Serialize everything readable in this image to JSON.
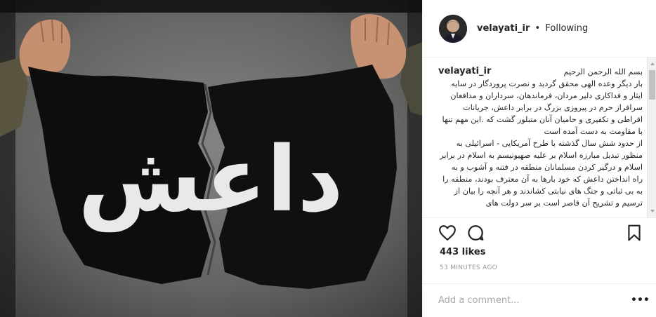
{
  "post": {
    "image_text": "داعش",
    "image_description": "flag being torn apart by two hands"
  },
  "header": {
    "username": "velayati_ir",
    "separator": "•",
    "follow_status": "Following"
  },
  "caption": {
    "username": "velayati_ir",
    "text": "بسم الله الرحمن الرحیم\nبار دیگر وعده الهی محقق گردید و نصرت پروردگار در سایه ایثار و فداکاری دلیر مردان، فرماندهان، سرداران و مدافعان سرافراز حرم در پیروزی بزرگ در برابر داعش، جریانات افراطی و تکفیری و حامیان آنان متبلور گشت که .این مهم تنها با مقاومت به دست آمده است\nاز حدود شش سال گذشته با طرح آمریکایی - اسرائیلی به منظور تبدیل مبارزه اسلام بر علیه صهیونیسم به اسلام در برابر اسلام و درگیر کردن مسلمانان منطقه در فتنه و آشوب و به راه انداختن داعش که خود بارها به آن معترف بودند، منطقه را به بی ثباتی و جنگ های نیابتی کشاندند و هر آنچه را بیان از ترسیم و تشریح آن قاصر است بر سر دولت های"
  },
  "actions": {
    "like_icon": "heart-icon",
    "comment_icon": "comment-icon",
    "save_icon": "bookmark-icon"
  },
  "stats": {
    "likes": "443 likes",
    "time": "53 MINUTES AGO"
  },
  "comment": {
    "placeholder": "Add a comment...",
    "more": "•••"
  },
  "colors": {
    "text": "#262626",
    "muted": "#999999",
    "border": "#efefef"
  }
}
